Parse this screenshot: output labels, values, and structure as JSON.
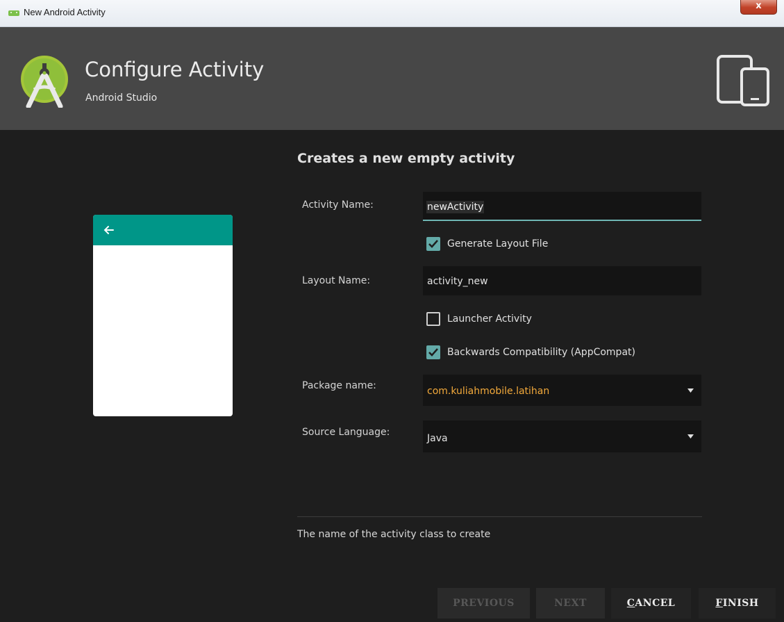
{
  "window": {
    "title": "New Android Activity",
    "close_symbol": "x"
  },
  "header": {
    "title": "Configure Activity",
    "subtitle": "Android Studio",
    "logo_icon": "android-studio-logo",
    "device_icon": "phone-tablet-icon"
  },
  "main": {
    "heading": "Creates a new empty activity",
    "preview": {
      "back_icon": "arrow-left-icon",
      "toolbar_color": "#009688"
    },
    "activity_name": {
      "label": "Activity Name:",
      "value": "newActivity"
    },
    "generate_layout": {
      "label": "Generate Layout File",
      "checked": true
    },
    "layout_name": {
      "label": "Layout Name:",
      "value": "activity_new"
    },
    "launcher_activity": {
      "label": "Launcher Activity",
      "checked": false
    },
    "backwards_compat": {
      "label": "Backwards Compatibility (AppCompat)",
      "checked": true
    },
    "package_name": {
      "label": "Package name:",
      "value": "com.kuliahmobile.latihan"
    },
    "source_language": {
      "label": "Source Language:",
      "value": "Java"
    },
    "help_text": "The name of the activity class to create"
  },
  "buttons": {
    "previous": "PREVIOUS",
    "next": "NEXT",
    "cancel_first": "C",
    "cancel_rest": "ANCEL",
    "finish_first": "F",
    "finish_rest": "INISH"
  },
  "colors": {
    "accent": "#63aaa8",
    "package_text": "#f2a93b",
    "header_bg": "#474747",
    "body_bg": "#1e1e1e"
  }
}
